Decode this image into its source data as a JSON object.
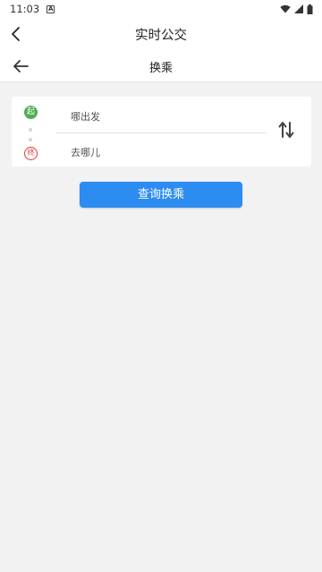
{
  "status_bar": {
    "time": "11:03",
    "notification_icon": "a-box-icon",
    "icons": [
      "wifi-icon",
      "signal-icon",
      "battery-icon"
    ]
  },
  "app_bar": {
    "title": "实时公交",
    "back_icon": "chevron-left-icon"
  },
  "sub_bar": {
    "title": "换乘",
    "back_icon": "arrow-left-icon"
  },
  "route_card": {
    "start_badge": "起",
    "end_badge": "终",
    "from_placeholder": "哪出发",
    "to_placeholder": "去哪儿",
    "swap_icon": "swap-vertical-icon"
  },
  "query_button": {
    "label": "查询换乘"
  },
  "colors": {
    "accent": "#2d8cf0",
    "start": "#4caf50",
    "end": "#e53935",
    "background": "#f2f2f2"
  }
}
